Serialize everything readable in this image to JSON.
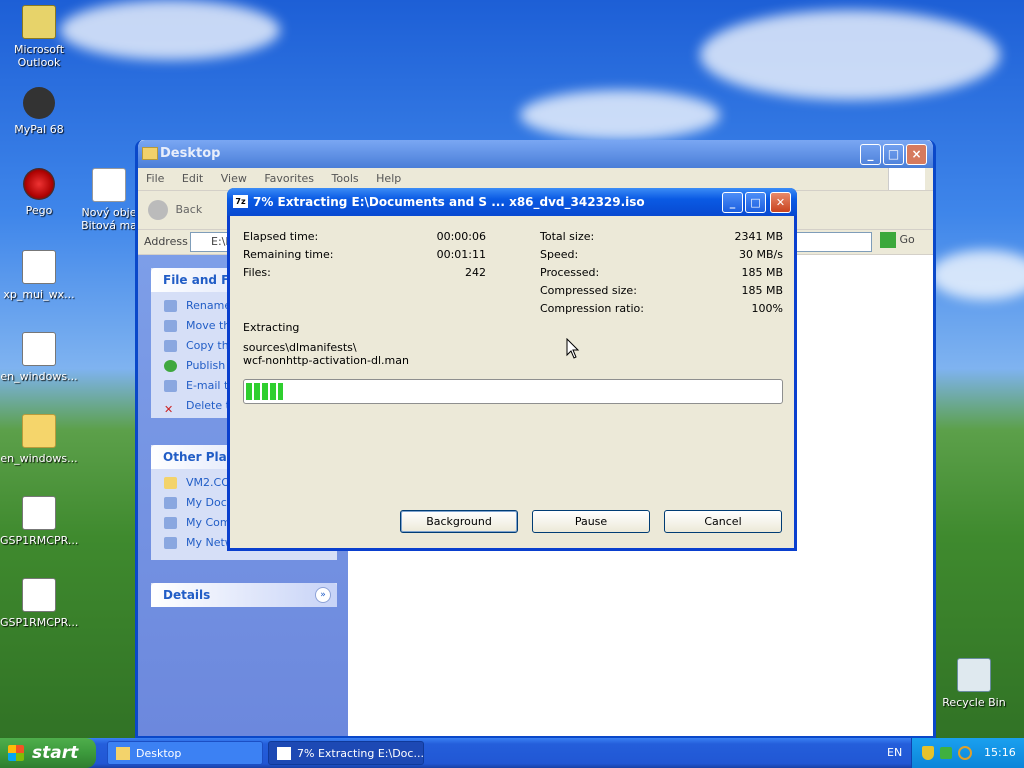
{
  "desktop": {
    "icons": [
      {
        "label": "Microsoft Outlook",
        "icon": "outlook-icon"
      },
      {
        "label": "MyPal 68",
        "icon": "mypal-icon"
      },
      {
        "label": "Pego",
        "icon": "pego-icon"
      },
      {
        "label": "Nový obje Bitová ma",
        "icon": "bitmap-file-icon"
      },
      {
        "label": "xp_mui_wx...",
        "icon": "file-icon"
      },
      {
        "label": "en_windows...",
        "icon": "iso-file-icon"
      },
      {
        "label": "en_windows...",
        "icon": "folder-icon"
      },
      {
        "label": "GSP1RMCPR...",
        "icon": "iso-file-icon"
      },
      {
        "label": "GSP1RMCPR...",
        "icon": "iso-file-icon"
      },
      {
        "label": "Recycle Bin",
        "icon": "recycle-bin-icon"
      }
    ]
  },
  "explorer": {
    "title": "Desktop",
    "menu": [
      "File",
      "Edit",
      "View",
      "Favorites",
      "Tools",
      "Help"
    ],
    "toolbar": {
      "back": "Back"
    },
    "address": {
      "label": "Address",
      "value": "E:\\D",
      "go": "Go"
    },
    "file_tasks": {
      "title": "File and Fol",
      "items": [
        "Rename",
        "Move thi",
        "Copy thi",
        "Publish th",
        "E-mail th",
        "Delete th"
      ]
    },
    "other_places": {
      "title": "Other Place",
      "items": [
        "VM2.CO",
        "My Docu",
        "My Comp",
        "My Netw"
      ]
    },
    "details": {
      "title": "Details"
    }
  },
  "dialog": {
    "title": "7% Extracting E:\\Documents and S ... x86_dvd_342329.iso",
    "progress_percent": 7,
    "stats_left": [
      {
        "label": "Elapsed time:",
        "value": "00:00:06"
      },
      {
        "label": "Remaining time:",
        "value": "00:01:11"
      },
      {
        "label": "Files:",
        "value": "242"
      }
    ],
    "stats_right": [
      {
        "label": "Total size:",
        "value": "2341 MB"
      },
      {
        "label": "Speed:",
        "value": "30 MB/s"
      },
      {
        "label": "Processed:",
        "value": "185 MB"
      },
      {
        "label": "Compressed size:",
        "value": "185 MB"
      },
      {
        "label": "Compression ratio:",
        "value": "100%"
      }
    ],
    "status": "Extracting",
    "current_path": "sources\\dlmanifests\\",
    "current_file": "wcf-nonhttp-activation-dl.man",
    "buttons": {
      "background": "Background",
      "pause": "Pause",
      "cancel": "Cancel"
    }
  },
  "taskbar": {
    "start": "start",
    "tasks": [
      "Desktop",
      "7% Extracting E:\\Doc..."
    ],
    "language": "EN",
    "time": "15:16"
  }
}
